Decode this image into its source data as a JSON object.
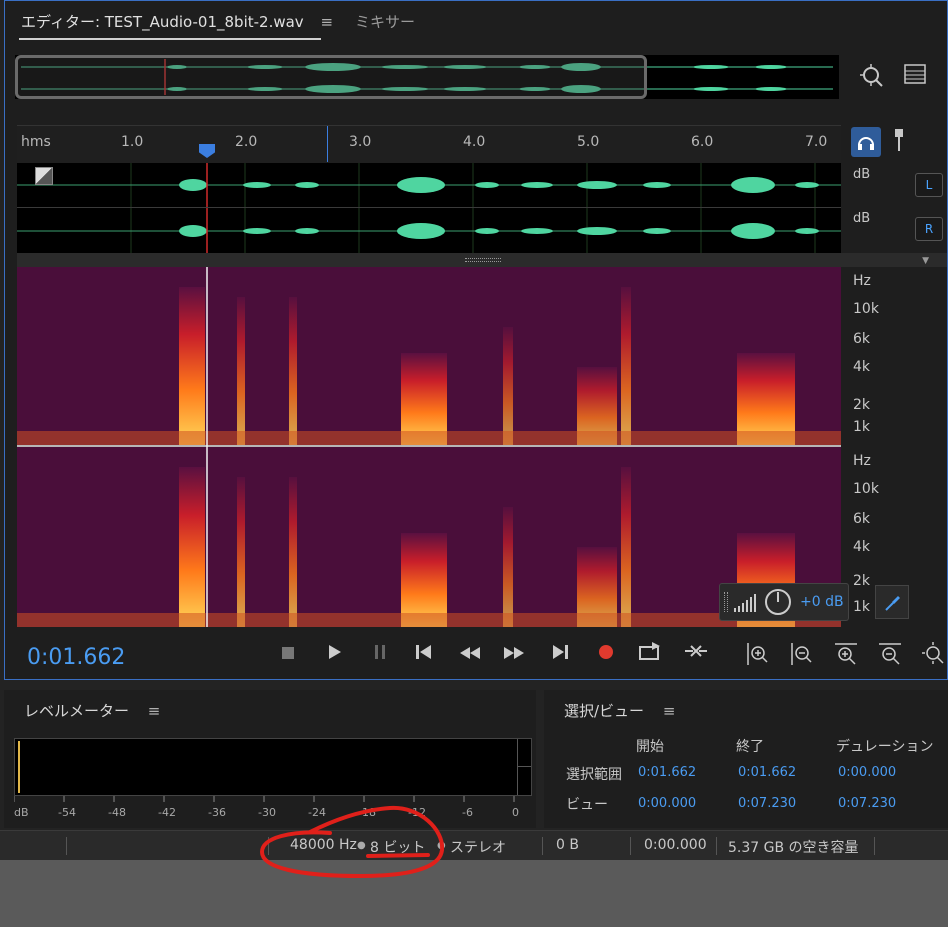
{
  "tabs": {
    "editor_label": "エディター: TEST_Audio-01_8bit-2.wav",
    "menu_glyph": "≡",
    "mixer_label": "ミキサー"
  },
  "ruler": {
    "unit_label": "hms",
    "labels": [
      "1.0",
      "2.0",
      "3.0",
      "4.0",
      "5.0",
      "6.0",
      "7.0"
    ]
  },
  "waveform": {
    "db_top": "dB",
    "db_bottom": "dB",
    "left_channel": "L",
    "right_channel": "R",
    "color": "#4fd5a0"
  },
  "spectrogram": {
    "top_labels": [
      "Hz",
      "10k",
      "6k",
      "4k",
      "2k",
      "1k"
    ],
    "bottom_labels": [
      "Hz",
      "10k",
      "6k",
      "4k",
      "2k",
      "1k"
    ]
  },
  "gain": {
    "value": "+0 dB"
  },
  "transport": {
    "timecode": "0:01.662",
    "record_color": "#e03a2e",
    "accent": "#4a9cf2"
  },
  "level_meter": {
    "title": "レベルメーター",
    "menu_glyph": "≡",
    "scale": [
      "dB",
      "-54",
      "-48",
      "-42",
      "-36",
      "-30",
      "-24",
      "-18",
      "-12",
      "-6",
      "0"
    ]
  },
  "selection_view": {
    "title": "選択/ビュー",
    "menu_glyph": "≡",
    "col_start": "開始",
    "col_end": "終了",
    "col_duration": "デュレーション",
    "row_selection": "選択範囲",
    "row_view": "ビュー",
    "selection": {
      "start": "0:01.662",
      "end": "0:01.662",
      "duration": "0:00.000"
    },
    "view": {
      "start": "0:00.000",
      "end": "0:07.230",
      "duration": "0:07.230"
    }
  },
  "status_bar": {
    "sample_rate": "48000 Hz",
    "bit_depth": "8 ビット",
    "channels": "ステレオ",
    "file_size": "0 B",
    "duration": "0:00.000",
    "free_space": "5.37 GB の空き容量",
    "bullet": "●"
  }
}
